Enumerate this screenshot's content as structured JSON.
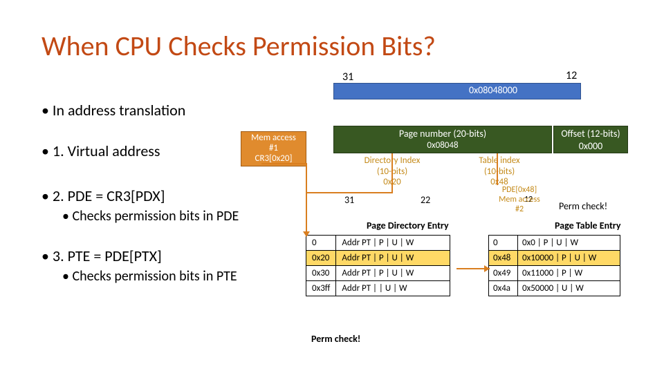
{
  "title": "When CPU Checks Permission Bits?",
  "bits": {
    "b31": "31",
    "b12": "12",
    "b31b": "31",
    "b22": "22",
    "b12b": "12"
  },
  "address": {
    "value": "0x08048000"
  },
  "bullets": {
    "b1": "• In address translation",
    "b2": "• 1. Virtual address",
    "b3": "• 2. PDE = CR3[PDX]",
    "b3s": "• Checks permission bits in PDE",
    "b4": "• 3. PTE = PDE[PTX]",
    "b4s": "• Checks permission bits in PTE"
  },
  "memacc1": {
    "l1": "Mem access",
    "l2": "#1",
    "l3": "CR3[0x20]"
  },
  "pagenum": {
    "l1": "Page number (20-bits)",
    "l2": "0x08048"
  },
  "offset": {
    "l1": "Offset (12-bits)",
    "l2": "0x000"
  },
  "dir": {
    "l1": "Directory Index",
    "l2": "(10-bits)",
    "l3": "0x20"
  },
  "tbl": {
    "l1": "Table index",
    "l2": "(10-bits)",
    "l3": "0x48"
  },
  "pde_label": "PDE[0x48]",
  "memacc2": {
    "l1": "Mem access",
    "l2": "#2"
  },
  "perm_r": "Perm check!",
  "pde_hdr": "Page Directory Entry",
  "pte_hdr": "Page Table Entry",
  "pde_rows": [
    {
      "idx": "0",
      "val": "Addr PT | P | U | W"
    },
    {
      "idx": "0x20",
      "val": "Addr PT | P | U | W"
    },
    {
      "idx": "0x30",
      "val": "Addr PT | P | U | W"
    },
    {
      "idx": "0x3ff",
      "val": "Addr PT |      | U | W"
    }
  ],
  "pte_rows": [
    {
      "idx": "0",
      "val": "0x0 | P | U | W"
    },
    {
      "idx": "0x48",
      "val": "0x10000 | P | U | W"
    },
    {
      "idx": "0x49",
      "val": "0x11000 | P | W"
    },
    {
      "idx": "0x4a",
      "val": "0x50000 | U | W"
    }
  ],
  "perm_bottom": "Perm check!"
}
